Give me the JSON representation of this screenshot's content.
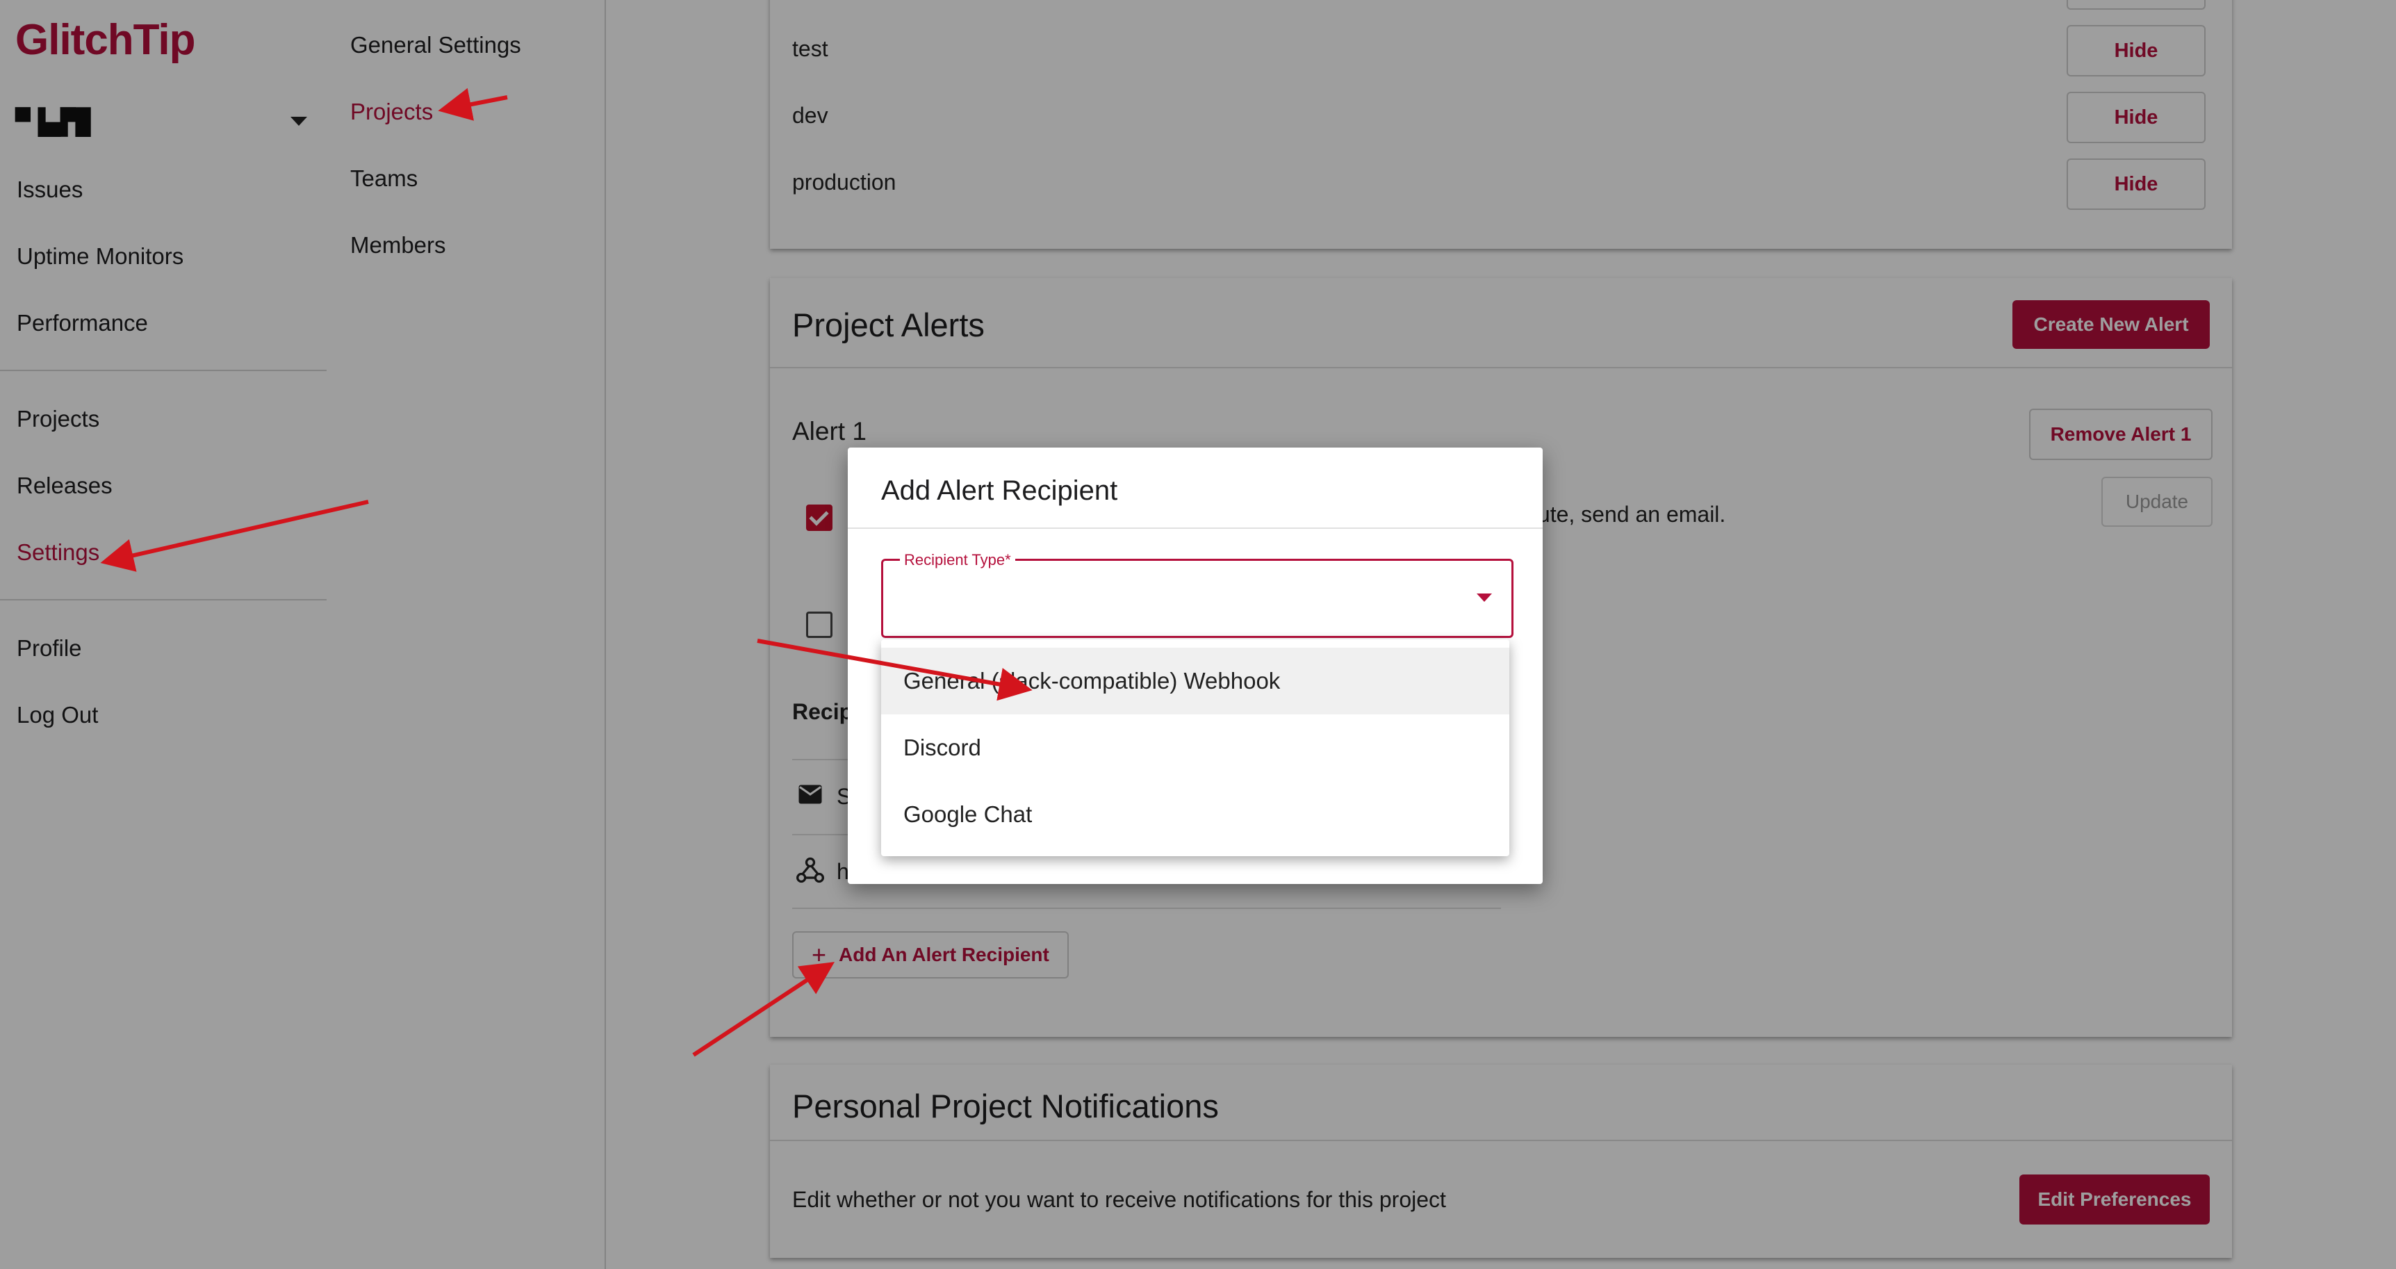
{
  "app": {
    "logo": "GlitchTip",
    "org_name": "▀▐▄▛█"
  },
  "left_nav": {
    "items": [
      {
        "label": "Issues"
      },
      {
        "label": "Uptime Monitors"
      },
      {
        "label": "Performance"
      },
      {
        "label": "Projects"
      },
      {
        "label": "Releases"
      },
      {
        "label": "Settings",
        "active": true
      },
      {
        "label": "Profile"
      },
      {
        "label": "Log Out"
      }
    ]
  },
  "settings_nav": {
    "items": [
      {
        "label": "General Settings"
      },
      {
        "label": "Projects",
        "active": true
      },
      {
        "label": "Teams"
      },
      {
        "label": "Members"
      }
    ]
  },
  "environments": {
    "rows": [
      {
        "name": "test",
        "action": "Hide"
      },
      {
        "name": "dev",
        "action": "Hide"
      },
      {
        "name": "production",
        "action": "Hide"
      }
    ]
  },
  "project_alerts": {
    "title": "Project Alerts",
    "create_button": "Create New Alert",
    "alert_title": "Alert 1",
    "remove_button": "Remove Alert 1",
    "update_button": "Update",
    "condition_text": "inute, send an email.",
    "recipients_heading": "Recip",
    "recipient_1_text": "S",
    "recipient_2_text": "h",
    "add_recipient_button": "Add An Alert Recipient"
  },
  "personal_notifications": {
    "title": "Personal Project Notifications",
    "description": "Edit whether or not you want to receive notifications for this project",
    "button": "Edit Preferences"
  },
  "dialog": {
    "title": "Add Alert Recipient",
    "field_label": "Recipient Type*",
    "options": [
      {
        "label": "General (slack-compatible) Webhook"
      },
      {
        "label": "Discord"
      },
      {
        "label": "Google Chat"
      }
    ]
  },
  "colors": {
    "brand": "#b5103c",
    "annotation_arrow": "#d3141c"
  }
}
